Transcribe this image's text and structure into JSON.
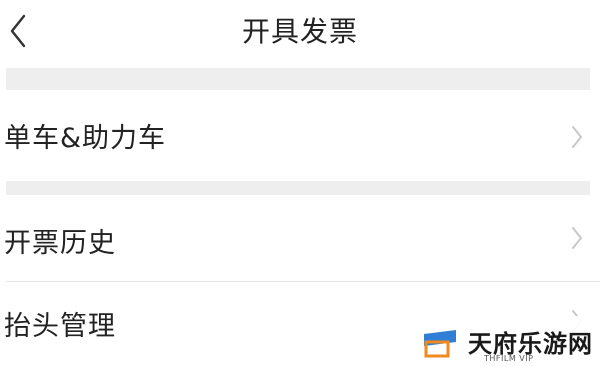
{
  "header": {
    "title": "开具发票",
    "back_icon": "chevron-left-icon"
  },
  "menu": {
    "items": [
      {
        "label": "单车&助力车",
        "icon": "chevron-right-icon"
      },
      {
        "label": "开票历史",
        "icon": "chevron-right-icon"
      },
      {
        "label": "抬头管理",
        "icon": "chevron-right-icon"
      }
    ]
  },
  "watermark": {
    "name": "天府乐游网",
    "sub": "THFILM VIP"
  },
  "colors": {
    "background": "#ffffff",
    "section_gap": "#eeeeee",
    "text": "#222222",
    "chevron": "#c8c8c8",
    "watermark_blue": "#2f7fd6",
    "watermark_orange": "#f08a1c"
  }
}
